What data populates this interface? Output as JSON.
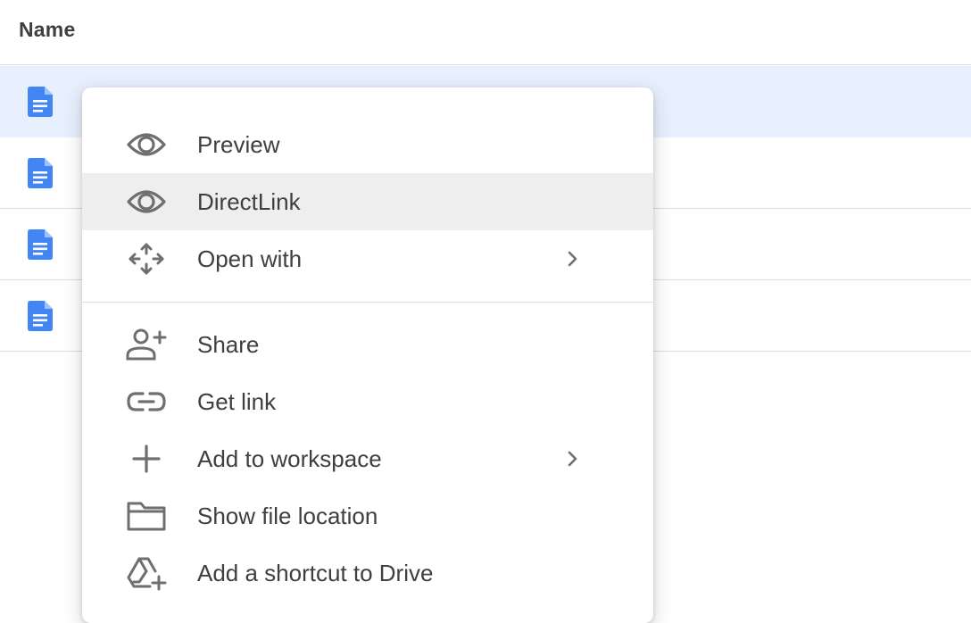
{
  "file_list": {
    "column_header": "Name",
    "rows": [
      {
        "icon": "google-docs-icon",
        "selected": true
      },
      {
        "icon": "google-docs-icon",
        "selected": false
      },
      {
        "icon": "google-docs-icon",
        "selected": false
      },
      {
        "icon": "google-docs-icon",
        "selected": false
      }
    ]
  },
  "context_menu": {
    "items": [
      {
        "label": "Preview",
        "icon": "eye-icon"
      },
      {
        "label": "DirectLink",
        "icon": "eye-icon",
        "hovered": true
      },
      {
        "label": "Open with",
        "icon": "move-arrows-icon",
        "submenu": true
      },
      {
        "label": "Share",
        "icon": "person-add-icon"
      },
      {
        "label": "Get link",
        "icon": "link-icon"
      },
      {
        "label": "Add to workspace",
        "icon": "plus-icon",
        "submenu": true
      },
      {
        "label": "Show file location",
        "icon": "folder-icon"
      },
      {
        "label": "Add a shortcut to Drive",
        "icon": "drive-shortcut-icon"
      }
    ]
  },
  "colors": {
    "selected_row": "#e8f0fe",
    "doc_icon_blue": "#4285f4",
    "menu_hover": "#eeeeee",
    "icon_gray": "#6f6f6f",
    "text": "#3c4043",
    "divider": "#dadce0"
  }
}
